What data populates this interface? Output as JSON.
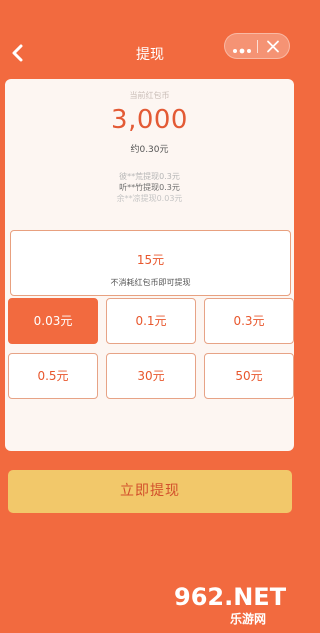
{
  "header": {
    "title": "提现"
  },
  "balance": {
    "label": "当前红包币",
    "amount": "3,000",
    "approx": "约0.30元"
  },
  "ticker": [
    "彼**荒提现0.3元",
    "听**竹提现0.3元",
    "余**凉提现0.03元"
  ],
  "special_option": {
    "amount": "15元",
    "note": "不消耗红包币即可提现"
  },
  "options": [
    {
      "label": "0.03元",
      "selected": true
    },
    {
      "label": "0.1元",
      "selected": false
    },
    {
      "label": "0.3元",
      "selected": false
    },
    {
      "label": "0.5元",
      "selected": false
    },
    {
      "label": "30元",
      "selected": false
    },
    {
      "label": "50元",
      "selected": false
    }
  ],
  "withdraw_button": "立即提现",
  "watermark": {
    "brand": "962.NET",
    "subtitle": "乐游网"
  },
  "colors": {
    "primary": "#f26a3f",
    "accent_text": "#e8572d",
    "button": "#f2c86a"
  }
}
